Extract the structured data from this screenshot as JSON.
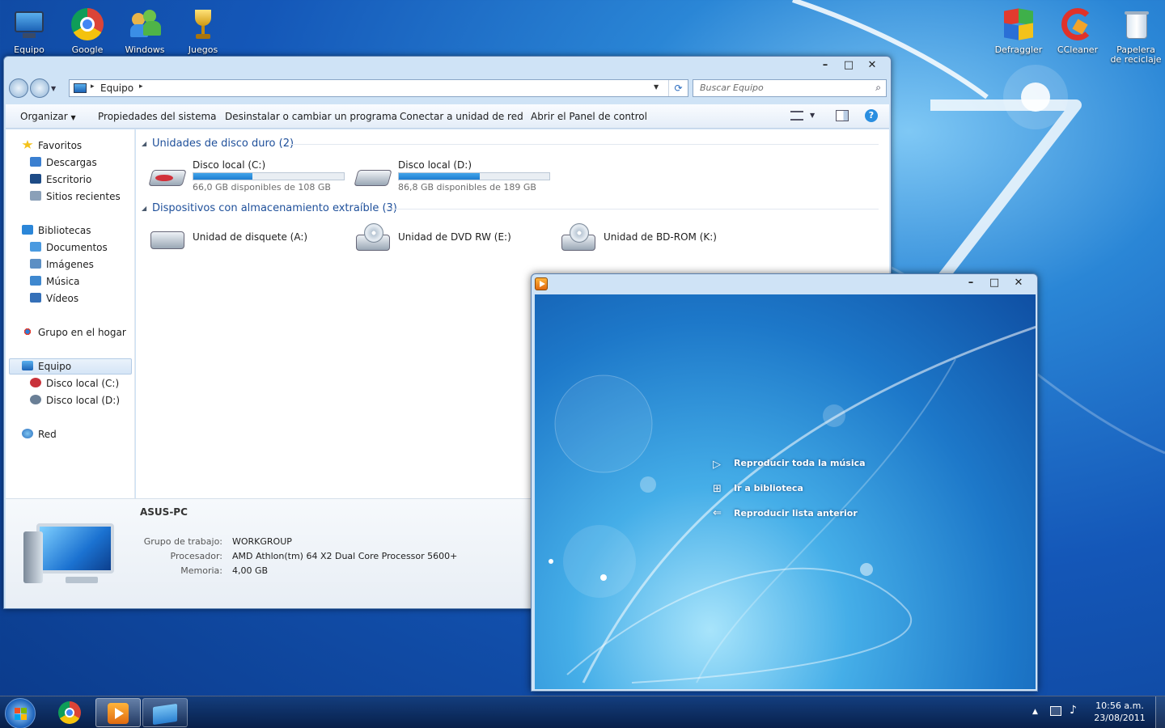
{
  "desktop": {
    "icons_left": [
      {
        "label": "Equipo",
        "icon": "computer-icon"
      },
      {
        "label": "Google",
        "icon": "chrome-icon"
      },
      {
        "label": "Windows",
        "icon": "windows-live-icon"
      },
      {
        "label": "Juegos",
        "icon": "trophy-icon"
      }
    ],
    "icons_right": [
      {
        "label": "Defraggler",
        "icon": "defraggler-icon"
      },
      {
        "label": "CCleaner",
        "icon": "ccleaner-icon"
      },
      {
        "label": "Papelera de reciclaje",
        "icon": "recycle-bin-icon"
      }
    ]
  },
  "explorer": {
    "caption": {
      "minimize": "–",
      "maximize": "□",
      "close": "✕"
    },
    "address": {
      "location": "Equipo",
      "sep": "▸"
    },
    "search_placeholder": "Buscar Equipo",
    "toolbar": {
      "organize": "Organizar",
      "system_properties": "Propiedades del sistema",
      "uninstall": "Desinstalar o cambiar un programa",
      "map_drive": "Conectar a unidad de red",
      "control_panel": "Abrir el Panel de control"
    },
    "nav": {
      "favorites": "Favoritos",
      "downloads": "Descargas",
      "desktop": "Escritorio",
      "recent": "Sitios recientes",
      "libraries": "Bibliotecas",
      "documents": "Documentos",
      "pictures": "Imágenes",
      "music": "Música",
      "videos": "Vídeos",
      "homegroup": "Grupo en el hogar",
      "computer": "Equipo",
      "disk_c": "Disco local (C:)",
      "disk_d": "Disco local (D:)",
      "network": "Red"
    },
    "hard_disks": {
      "heading": "Unidades de disco duro (2)",
      "items": [
        {
          "name": "Disco local (C:)",
          "free": "66,0 GB disponibles de 108 GB",
          "used_fraction": 0.39
        },
        {
          "name": "Disco local (D:)",
          "free": "86,8 GB disponibles de 189 GB",
          "used_fraction": 0.54
        }
      ]
    },
    "removable": {
      "heading": "Dispositivos con almacenamiento extraíble (3)",
      "items": [
        {
          "name": "Unidad de disquete (A:)"
        },
        {
          "name": "Unidad de DVD RW (E:)"
        },
        {
          "name": "Unidad de BD-ROM (K:)"
        }
      ]
    },
    "details": {
      "computer_name": "ASUS-PC",
      "workgroup_label": "Grupo de trabajo:",
      "workgroup_value": "WORKGROUP",
      "processor_label": "Procesador:",
      "processor_value": "AMD Athlon(tm) 64 X2 Dual Core Processor 5600+",
      "memory_label": "Memoria:",
      "memory_value": "4,00 GB"
    }
  },
  "media_player": {
    "caption": {
      "minimize": "–",
      "maximize": "□",
      "close": "✕"
    },
    "actions": [
      {
        "label": "Reproducir toda la música",
        "icon": "play-icon"
      },
      {
        "label": "Ir a biblioteca",
        "icon": "library-icon"
      },
      {
        "label": "Reproducir lista anterior",
        "icon": "back-arrow-icon"
      }
    ]
  },
  "taskbar": {
    "time": "10:56 a.m.",
    "date": "23/08/2011",
    "tray_arrow": "▲"
  },
  "colors": {
    "link_blue": "#1e4f9a",
    "bar_fill": "#2b8fdc",
    "taskbar": "#0e2c63"
  }
}
